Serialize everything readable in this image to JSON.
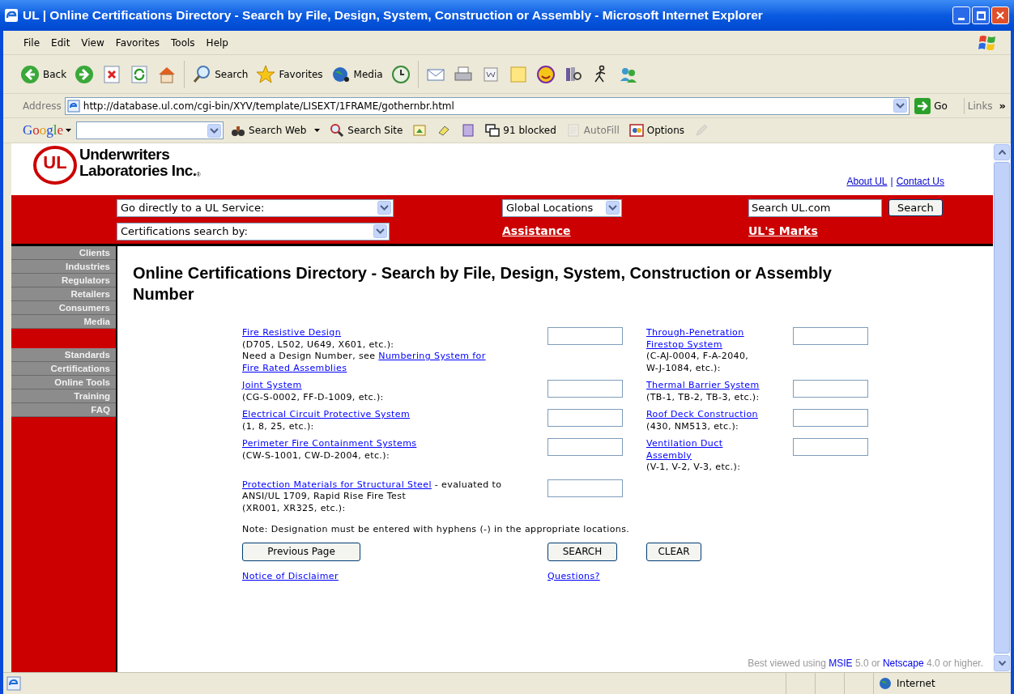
{
  "window": {
    "title": "UL | Online Certifications Directory - Search by File, Design, System, Construction or Assembly - Microsoft Internet Explorer"
  },
  "menu": [
    "File",
    "Edit",
    "View",
    "Favorites",
    "Tools",
    "Help"
  ],
  "toolbar": [
    {
      "kind": "back",
      "label": "Back"
    },
    {
      "kind": "forward"
    },
    {
      "kind": "stop"
    },
    {
      "kind": "refresh"
    },
    {
      "kind": "home"
    },
    {
      "kind": "separator"
    },
    {
      "kind": "search",
      "label": "Search"
    },
    {
      "kind": "favorites",
      "label": "Favorites"
    },
    {
      "kind": "media",
      "label": "Media"
    },
    {
      "kind": "history"
    },
    {
      "kind": "separator"
    },
    {
      "kind": "mail"
    },
    {
      "kind": "print"
    },
    {
      "kind": "edit"
    },
    {
      "kind": "note"
    },
    {
      "kind": "messenger"
    },
    {
      "kind": "research"
    },
    {
      "kind": "walker"
    },
    {
      "kind": "people"
    }
  ],
  "address": {
    "label": "Address",
    "value": "http://database.ul.com/cgi-bin/XYV/template/LISEXT/1FRAME/gothernbr.html",
    "go": "Go",
    "links": "Links",
    "more": "»"
  },
  "google_bar": {
    "logo": "Google",
    "buttons": [
      {
        "kind": "search-web",
        "label": "Search Web",
        "disabled": false
      },
      {
        "kind": "search-site",
        "label": "Search Site",
        "disabled": false
      },
      {
        "kind": "news",
        "disabled": false
      },
      {
        "kind": "highlight",
        "disabled": false
      },
      {
        "kind": "page-rank",
        "disabled": false
      },
      {
        "kind": "popup",
        "label": "91 blocked",
        "disabled": false
      },
      {
        "kind": "autofill",
        "label": "AutoFill",
        "disabled": true
      },
      {
        "kind": "options",
        "label": "Options",
        "disabled": false
      },
      {
        "kind": "pencil",
        "disabled": true
      }
    ]
  },
  "header": {
    "logo_mark": "UL",
    "logo_line1": "Underwriters",
    "logo_line2": "Laboratories Inc.",
    "registered": "®",
    "links": [
      "About UL",
      "Contact Us"
    ],
    "separator": "|"
  },
  "nav": {
    "service_select": "Go directly to a UL Service:",
    "certifications_select": "Certifications search by:",
    "locations_select": "Global Locations",
    "search_field": "Search UL.com",
    "search_button": "Search",
    "links": [
      "Assistance",
      "UL's Marks"
    ]
  },
  "sidebar": {
    "groups": [
      [
        "Clients",
        "Industries",
        "Regulators",
        "Retailers",
        "Consumers",
        "Media"
      ],
      [
        "Standards",
        "Certifications",
        "Online Tools",
        "Training",
        "FAQ"
      ]
    ]
  },
  "main": {
    "heading": "Online Certifications Directory - Search by File, Design, System, Construction or Assembly Number",
    "rows": [
      {
        "fields": [
          {
            "lines": [
              [
                {
                  "kind": "link",
                  "text": "Fire Resistive Design"
                }
              ],
              [
                {
                  "kind": "text",
                  "text": "(D705, L502, U649, X601, etc.):"
                }
              ],
              [
                {
                  "kind": "text",
                  "text": "Need a Design Number, see "
                },
                {
                  "kind": "link",
                  "text": "Numbering System for"
                }
              ],
              [
                {
                  "kind": "link",
                  "text": "Fire Rated Assemblies"
                }
              ]
            ]
          },
          {
            "lines": [
              [
                {
                  "kind": "link",
                  "text": "Through-Penetration"
                }
              ],
              [
                {
                  "kind": "link",
                  "text": "Firestop System"
                }
              ],
              [
                {
                  "kind": "text",
                  "text": "(C-AJ-0004, F-A-2040,"
                }
              ],
              [
                {
                  "kind": "text",
                  "text": "W-J-1084, etc.):"
                }
              ]
            ]
          }
        ]
      },
      {
        "fields": [
          {
            "lines": [
              [
                {
                  "kind": "link",
                  "text": "Joint System"
                }
              ],
              [
                {
                  "kind": "text",
                  "text": "(CG-S-0002, FF-D-1009, etc.):"
                }
              ]
            ]
          },
          {
            "lines": [
              [
                {
                  "kind": "link",
                  "text": "Thermal Barrier System"
                }
              ],
              [
                {
                  "kind": "text",
                  "text": "(TB-1, TB-2, TB-3, etc.):"
                }
              ]
            ]
          }
        ]
      },
      {
        "fields": [
          {
            "lines": [
              [
                {
                  "kind": "link",
                  "text": "Electrical Circuit Protective System"
                }
              ],
              [
                {
                  "kind": "text",
                  "text": "(1, 8, 25, etc.):"
                }
              ]
            ]
          },
          {
            "lines": [
              [
                {
                  "kind": "link",
                  "text": "Roof Deck Construction"
                }
              ],
              [
                {
                  "kind": "text",
                  "text": "(430, NM513, etc.):"
                }
              ]
            ]
          }
        ]
      },
      {
        "fields": [
          {
            "lines": [
              [
                {
                  "kind": "link",
                  "text": "Perimeter Fire Containment Systems"
                }
              ],
              [
                {
                  "kind": "text",
                  "text": "(CW-S-1001, CW-D-2004, etc.):"
                }
              ]
            ]
          },
          {
            "lines": [
              [
                {
                  "kind": "link",
                  "text": "Ventilation Duct"
                }
              ],
              [
                {
                  "kind": "link",
                  "text": "Assembly"
                }
              ],
              [
                {
                  "kind": "text",
                  "text": "(V-1, V-2, V-3, etc.):"
                }
              ]
            ]
          }
        ]
      },
      {
        "fields": [
          {
            "lines": [
              [
                {
                  "kind": "link",
                  "text": "Protection Materials for Structural Steel"
                },
                {
                  "kind": "text",
                  "text": " - evaluated to"
                }
              ],
              [
                {
                  "kind": "text",
                  "text": "ANSI/UL 1709, Rapid Rise Fire Test"
                }
              ],
              [
                {
                  "kind": "text",
                  "text": "(XR001, XR325, etc.):"
                }
              ]
            ]
          }
        ]
      }
    ],
    "note": "Note: Designation must be entered with hyphens (-) in the appropriate locations.",
    "previous_button": "Previous Page",
    "search_button": "SEARCH",
    "clear_button": "CLEAR",
    "disclaimer_link": "Notice of Disclaimer",
    "questions_link": "Questions?",
    "best_viewed": [
      {
        "kind": "text",
        "text": "Best viewed using "
      },
      {
        "kind": "link",
        "text": "MSIE"
      },
      {
        "kind": "text",
        "text": " 5.0 or "
      },
      {
        "kind": "link",
        "text": "Netscape"
      },
      {
        "kind": "text",
        "text": " 4.0 or higher."
      }
    ]
  },
  "status_bar": {
    "zone": "Internet"
  }
}
